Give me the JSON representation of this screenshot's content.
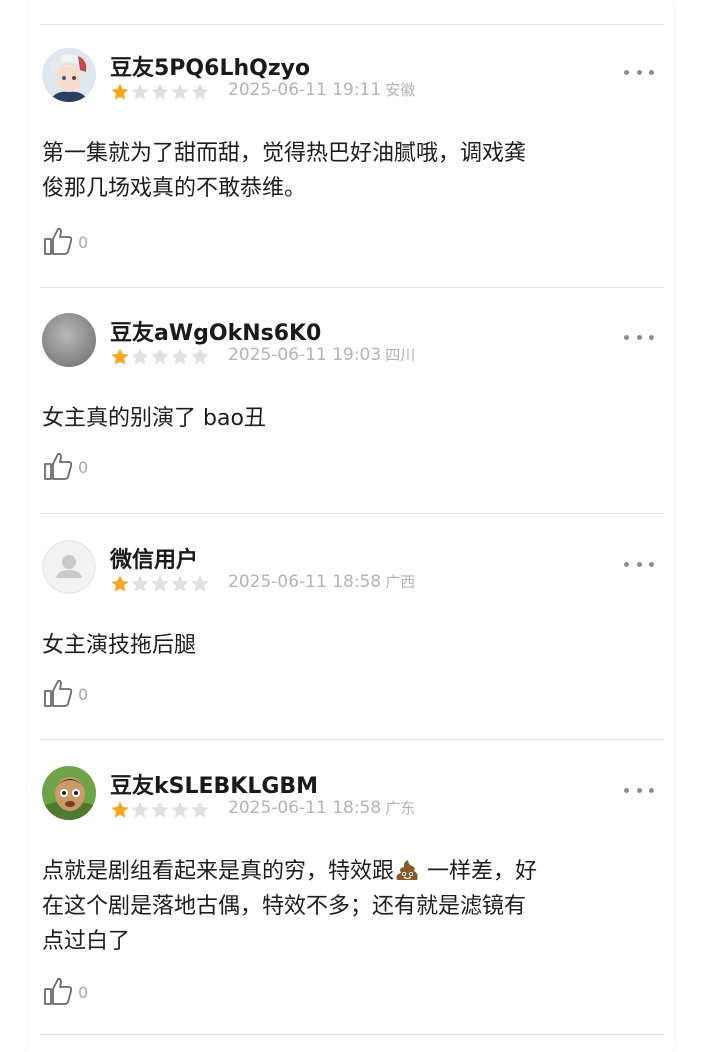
{
  "comments": [
    {
      "username": "豆友5PQ6LhQzyo",
      "rating": 1,
      "date": "2025-06-11 19:11",
      "location": "安徽",
      "text": "第一集就为了甜而甜，觉得热巴好油腻哦，调戏龚\n俊那几场戏真的不敢恭维。",
      "likes": "0",
      "avatar": "anime-character-avatar"
    },
    {
      "username": "豆友aWgOkNs6K0",
      "rating": 1,
      "date": "2025-06-11 19:03",
      "location": "四川",
      "text": "女主真的别演了 bao丑",
      "likes": "0",
      "avatar": "gray-blur-avatar"
    },
    {
      "username": "微信用户",
      "rating": 1,
      "date": "2025-06-11 18:58",
      "location": "广西",
      "text": "女主演技拖后腿",
      "likes": "0",
      "avatar": "default-user-avatar"
    },
    {
      "username": "豆友kSLEBKLGBM",
      "rating": 1,
      "date": "2025-06-11 18:58",
      "location": "广东",
      "text_part1": "点就是剧组看起来是真的穷，特效跟",
      "text_part2": " 一样差，好\n在这个剧是落地古偶，特效不多；还有就是滤镜有\n点过白了",
      "likes": "0",
      "avatar": "cartoon-face-avatar"
    }
  ],
  "colors": {
    "star_filled": "#f5a623",
    "star_empty": "#e0e0e0",
    "meta_text": "#b3b3b3",
    "divider": "#e4e4e4"
  }
}
